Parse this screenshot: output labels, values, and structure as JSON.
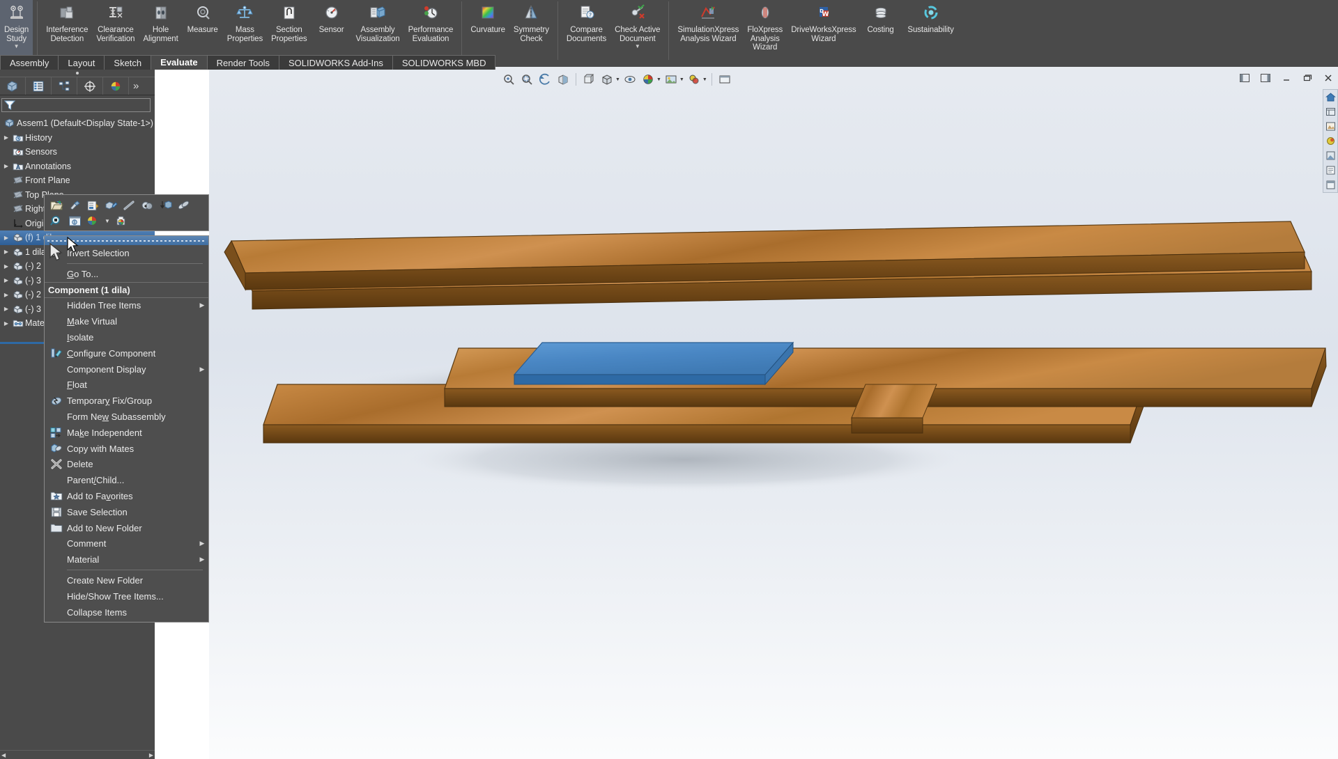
{
  "ribbon": {
    "groups": [
      {
        "buttons": [
          {
            "label": "Design\nStudy",
            "icon": "design-study-icon",
            "caret": true
          }
        ]
      },
      {
        "buttons": [
          {
            "label": "Interference\nDetection",
            "icon": "interference-detection-icon"
          },
          {
            "label": "Clearance\nVerification",
            "icon": "clearance-verification-icon"
          },
          {
            "label": "Hole\nAlignment",
            "icon": "hole-alignment-icon"
          },
          {
            "label": "Measure",
            "icon": "measure-icon"
          },
          {
            "label": "Mass\nProperties",
            "icon": "mass-properties-icon"
          },
          {
            "label": "Section\nProperties",
            "icon": "section-properties-icon"
          },
          {
            "label": "Sensor",
            "icon": "sensor-icon"
          },
          {
            "label": "Assembly\nVisualization",
            "icon": "assembly-visualization-icon"
          },
          {
            "label": "Performance\nEvaluation",
            "icon": "performance-evaluation-icon"
          }
        ]
      },
      {
        "buttons": [
          {
            "label": "Curvature",
            "icon": "curvature-icon"
          },
          {
            "label": "Symmetry\nCheck",
            "icon": "symmetry-check-icon"
          }
        ]
      },
      {
        "buttons": [
          {
            "label": "Compare\nDocuments",
            "icon": "compare-documents-icon"
          },
          {
            "label": "Check Active\nDocument",
            "icon": "check-active-document-icon",
            "caret": true
          }
        ]
      },
      {
        "buttons": [
          {
            "label": "SimulationXpress\nAnalysis Wizard",
            "icon": "simulationxpress-icon"
          },
          {
            "label": "FloXpress\nAnalysis\nWizard",
            "icon": "floxpress-icon"
          },
          {
            "label": "DriveWorksXpress\nWizard",
            "icon": "driveworksxpress-icon"
          },
          {
            "label": "Costing",
            "icon": "costing-icon"
          },
          {
            "label": "Sustainability",
            "icon": "sustainability-icon"
          }
        ]
      }
    ]
  },
  "tabs": [
    {
      "label": "Assembly",
      "active": false
    },
    {
      "label": "Layout",
      "active": false
    },
    {
      "label": "Sketch",
      "active": false
    },
    {
      "label": "Evaluate",
      "active": true
    },
    {
      "label": "Render Tools",
      "active": false
    },
    {
      "label": "SOLIDWORKS Add-Ins",
      "active": false
    },
    {
      "label": "SOLIDWORKS MBD",
      "active": false
    }
  ],
  "view_toolbar": {
    "buttons": [
      {
        "icon": "zoom-to-fit-icon"
      },
      {
        "icon": "zoom-to-area-icon"
      },
      {
        "icon": "previous-view-icon"
      },
      {
        "icon": "section-view-icon"
      },
      {
        "icon": "view-orientation-icon"
      },
      {
        "icon": "display-style-icon",
        "caret": true
      },
      {
        "icon": "hide-show-items-icon",
        "caret": true
      },
      {
        "icon": "edit-appearance-icon",
        "caret": true
      },
      {
        "icon": "apply-scene-icon",
        "caret": true
      },
      {
        "icon": "view-settings-icon",
        "caret": true
      },
      {
        "icon": "viewport-icon"
      }
    ]
  },
  "window_controls": [
    {
      "icon": "restore-pane-left-icon",
      "name": "pane-left-button"
    },
    {
      "icon": "restore-pane-right-icon",
      "name": "pane-right-button"
    },
    {
      "icon": "minimize-icon",
      "name": "minimize-button"
    },
    {
      "icon": "restore-icon",
      "name": "restore-button"
    },
    {
      "icon": "close-icon",
      "name": "close-button"
    }
  ],
  "left_panel": {
    "tabs": [
      {
        "icon": "feature-manager-tree-icon",
        "name": "tab-feature-manager",
        "active": true
      },
      {
        "icon": "property-manager-icon",
        "name": "tab-property-manager"
      },
      {
        "icon": "configuration-manager-icon",
        "name": "tab-configuration-manager"
      },
      {
        "icon": "dimxpert-manager-icon",
        "name": "tab-dimxpert-manager"
      },
      {
        "icon": "display-manager-icon",
        "name": "tab-display-manager"
      }
    ],
    "more_label": "»",
    "filter": {
      "icon": "filter-funnel-icon",
      "value": "",
      "placeholder": ""
    },
    "tree": [
      {
        "label": "Assem1  (Default<Display State-1>)",
        "icon": "assembly-icon",
        "indent": 0,
        "arrow": ""
      },
      {
        "label": "History",
        "icon": "history-folder-icon",
        "indent": 1,
        "arrow": "▶"
      },
      {
        "label": "Sensors",
        "icon": "sensors-folder-icon",
        "indent": 1,
        "arrow": ""
      },
      {
        "label": "Annotations",
        "icon": "annotations-folder-icon",
        "indent": 1,
        "arrow": "▶"
      },
      {
        "label": "Front Plane",
        "icon": "plane-icon",
        "indent": 1,
        "arrow": ""
      },
      {
        "label": "Top Plane",
        "icon": "plane-icon",
        "indent": 1,
        "arrow": ""
      },
      {
        "label": "Right Plane",
        "icon": "plane-icon",
        "indent": 1,
        "arrow": ""
      },
      {
        "label": "Origin",
        "icon": "origin-icon",
        "indent": 1,
        "arrow": ""
      },
      {
        "label": "(f) 1 dila...",
        "icon": "component-icon",
        "indent": 1,
        "arrow": "▶",
        "selected": true
      },
      {
        "label": "1 dila...",
        "icon": "component-icon",
        "indent": 1,
        "arrow": "▶"
      },
      {
        "label": "(-) 2 ...",
        "icon": "component-icon",
        "indent": 1,
        "arrow": "▶"
      },
      {
        "label": "(-) 3 ...",
        "icon": "component-icon",
        "indent": 1,
        "arrow": "▶"
      },
      {
        "label": "(-) 2 ...",
        "icon": "component-icon",
        "indent": 1,
        "arrow": "▶"
      },
      {
        "label": "(-) 3 ...",
        "icon": "component-icon",
        "indent": 1,
        "arrow": "▶"
      },
      {
        "label": "Mates",
        "icon": "mates-folder-icon",
        "indent": 1,
        "arrow": "▶"
      }
    ]
  },
  "context_toolbar": {
    "row1": [
      {
        "icon": "open-part-icon",
        "name": "open-part-button"
      },
      {
        "icon": "invert-selection-tool-icon",
        "name": "invert-selection-button"
      },
      {
        "icon": "change-suppression-icon",
        "name": "change-suppression-button"
      },
      {
        "icon": "component-properties-icon",
        "name": "component-properties-button"
      },
      {
        "icon": "hide-component-icon",
        "name": "hide-component-button"
      },
      {
        "icon": "isolate-icon",
        "name": "isolate-button"
      },
      {
        "icon": "fix-component-icon",
        "name": "fix-component-button"
      },
      {
        "icon": "mate-icon",
        "name": "mate-button"
      }
    ],
    "row2": [
      {
        "icon": "zoom-to-selection-icon",
        "name": "zoom-to-selection-button"
      },
      {
        "icon": "open-drawing-icon",
        "name": "open-drawing-button"
      },
      {
        "icon": "appearances-icon",
        "name": "appearances-button",
        "caret": true
      },
      {
        "icon": "edit-appearance-icon",
        "name": "edit-appearance-button"
      }
    ]
  },
  "context_menu": {
    "items": [
      {
        "type": "item",
        "label": "Invert Selection",
        "icon": "selection-arrow-icon",
        "underline": ""
      },
      {
        "type": "sep"
      },
      {
        "type": "item",
        "label": "Go To...",
        "icon": "",
        "underline": "G"
      },
      {
        "type": "section",
        "label": "Component (1 dila)"
      },
      {
        "type": "item",
        "label": "Hidden Tree Items",
        "icon": "",
        "submenu": true
      },
      {
        "type": "item",
        "label": "Make Virtual",
        "icon": "",
        "underline": "M"
      },
      {
        "type": "item",
        "label": "Isolate",
        "icon": "",
        "underline": "I"
      },
      {
        "type": "item",
        "label": "Configure Component",
        "icon": "configure-component-icon",
        "underline": "C"
      },
      {
        "type": "item",
        "label": "Component Display",
        "icon": "",
        "submenu": true
      },
      {
        "type": "item",
        "label": "Float",
        "icon": "",
        "underline": "F"
      },
      {
        "type": "item",
        "label": "Temporary Fix/Group",
        "icon": "temporary-fix-icon",
        "underline": "y"
      },
      {
        "type": "item",
        "label": "Form New Subassembly",
        "icon": "",
        "underline": "w"
      },
      {
        "type": "item",
        "label": "Make Independent",
        "icon": "make-independent-icon",
        "underline": "k"
      },
      {
        "type": "item",
        "label": "Copy with Mates",
        "icon": "copy-with-mates-icon"
      },
      {
        "type": "item",
        "label": "Delete",
        "icon": "delete-x-icon"
      },
      {
        "type": "item",
        "label": "Parent/Child...",
        "icon": "",
        "underline": "/"
      },
      {
        "type": "item",
        "label": "Add to Favorites",
        "icon": "add-to-favorites-icon",
        "underline": "v"
      },
      {
        "type": "item",
        "label": "Save Selection",
        "icon": "save-selection-icon"
      },
      {
        "type": "item",
        "label": "Add to New Folder",
        "icon": "add-to-new-folder-icon"
      },
      {
        "type": "item",
        "label": "Comment",
        "icon": "",
        "submenu": true
      },
      {
        "type": "item",
        "label": "Material",
        "icon": "",
        "submenu": true
      },
      {
        "type": "sep"
      },
      {
        "type": "item",
        "label": "Create New Folder",
        "icon": ""
      },
      {
        "type": "item",
        "label": "Hide/Show Tree Items...",
        "icon": ""
      },
      {
        "type": "item",
        "label": "Collapse Items",
        "icon": ""
      }
    ]
  },
  "right_toolbar": [
    {
      "icon": "home-view-icon",
      "name": "home-button"
    },
    {
      "icon": "display-pane-icon",
      "name": "display-pane-button"
    },
    {
      "icon": "appearances-tab-icon",
      "name": "appearances-tab-button"
    },
    {
      "icon": "scenes-tab-icon",
      "name": "scenes-tab-button"
    },
    {
      "icon": "decals-tab-icon",
      "name": "decals-tab-button"
    },
    {
      "icon": "custom-properties-icon",
      "name": "custom-properties-button"
    },
    {
      "icon": "view-palette-icon",
      "name": "view-palette-button"
    }
  ],
  "model": {
    "description": "Exploded wooden board assembly with a blue plate",
    "colors": {
      "wood_top": "#c98a45",
      "wood_side": "#9a6427",
      "wood_dark": "#6d4516",
      "blue_plate": "#4a87c4",
      "blue_plate_side": "#2e6aa5",
      "background_top": "#e6eaf0",
      "background_bottom": "#fbfcfd"
    }
  }
}
